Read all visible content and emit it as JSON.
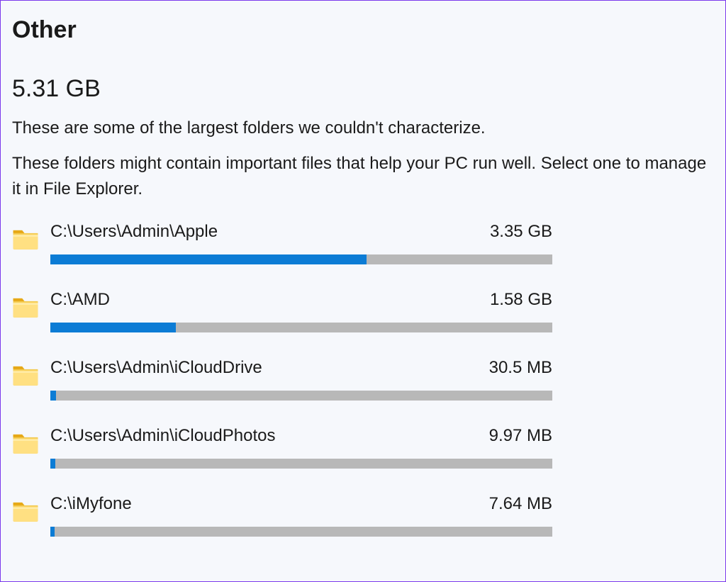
{
  "header": {
    "title": "Other",
    "total_size": "5.31 GB",
    "description1": "These are some of the largest folders we couldn't characterize.",
    "description2": "These folders might contain important files that help your PC run well. Select one to manage it in File Explorer."
  },
  "folders": [
    {
      "path": "C:\\Users\\Admin\\Apple",
      "size": "3.35 GB",
      "percent": 63
    },
    {
      "path": "C:\\AMD",
      "size": "1.58 GB",
      "percent": 25
    },
    {
      "path": "C:\\Users\\Admin\\iCloudDrive",
      "size": "30.5 MB",
      "percent": 1.2
    },
    {
      "path": "C:\\Users\\Admin\\iCloudPhotos",
      "size": "9.97 MB",
      "percent": 1
    },
    {
      "path": "C:\\iMyfone",
      "size": "7.64 MB",
      "percent": 0.9
    }
  ]
}
